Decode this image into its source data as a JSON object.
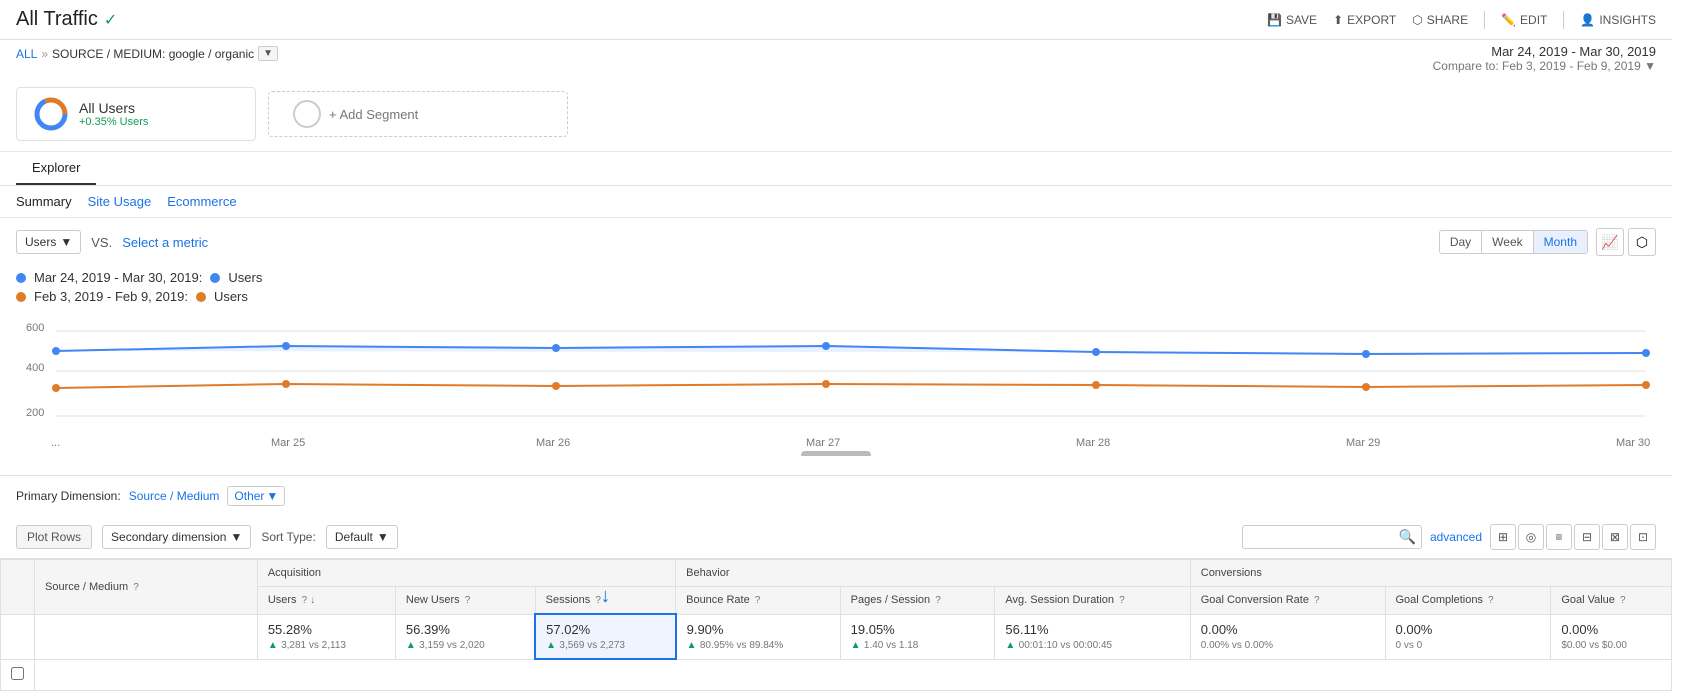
{
  "page": {
    "title": "All Traffic",
    "verified": true
  },
  "header": {
    "actions": [
      {
        "id": "save",
        "label": "SAVE",
        "icon": "💾"
      },
      {
        "id": "export",
        "label": "EXPORT",
        "icon": "📤"
      },
      {
        "id": "share",
        "label": "SHARE",
        "icon": "🔗"
      },
      {
        "id": "edit",
        "label": "EDIT",
        "icon": "✏️"
      },
      {
        "id": "insights",
        "label": "INSIGHTS",
        "icon": "👤"
      }
    ]
  },
  "breadcrumb": {
    "all": "ALL",
    "separator": "»",
    "path": "SOURCE / MEDIUM: google / organic"
  },
  "date_range": {
    "primary": "Mar 24, 2019 - Mar 30, 2019",
    "compare_label": "Compare to:",
    "compare": "Feb 3, 2019 - Feb 9, 2019"
  },
  "segments": {
    "all_users": {
      "name": "All Users",
      "pct": "+0.35% Users"
    },
    "add_label": "+ Add Segment"
  },
  "tabs": {
    "explorer": "Explorer"
  },
  "sub_tabs": [
    {
      "id": "summary",
      "label": "Summary",
      "active": true
    },
    {
      "id": "site_usage",
      "label": "Site Usage",
      "link": true
    },
    {
      "id": "ecommerce",
      "label": "Ecommerce",
      "link": true
    }
  ],
  "chart_controls": {
    "metric": "Users",
    "vs_label": "VS.",
    "select_metric": "Select a metric",
    "time_buttons": [
      "Day",
      "Week",
      "Month"
    ],
    "active_time": "Month"
  },
  "legend": {
    "row1": {
      "date": "Mar 24, 2019 - Mar 30, 2019:",
      "dot_color": "#4285f4",
      "metric": "Users"
    },
    "row2": {
      "date": "Feb 3, 2019 - Feb 9, 2019:",
      "dot_color": "#e07b2a",
      "metric": "Users"
    }
  },
  "chart": {
    "y_labels": [
      "600",
      "400",
      "200"
    ],
    "x_labels": [
      "...",
      "Mar 25",
      "Mar 26",
      "Mar 27",
      "Mar 28",
      "Mar 29",
      "Mar 30"
    ],
    "blue_line": [
      500,
      510,
      500,
      510,
      490,
      490,
      490,
      495
    ],
    "orange_line": [
      345,
      350,
      340,
      345,
      345,
      340,
      340,
      345
    ]
  },
  "primary_dimension": {
    "label": "Primary Dimension:",
    "current": "Source / Medium",
    "other": "Other"
  },
  "table_controls": {
    "plot_rows": "Plot Rows",
    "secondary_dimension": "Secondary dimension",
    "sort_type_label": "Sort Type:",
    "sort_default": "Default",
    "advanced": "advanced"
  },
  "table": {
    "col_groups": [
      {
        "label": "",
        "colspan": 2
      },
      {
        "label": "Acquisition",
        "colspan": 3
      },
      {
        "label": "Behavior",
        "colspan": 3
      },
      {
        "label": "Conversions",
        "colspan": 3
      }
    ],
    "columns": [
      {
        "id": "checkbox",
        "label": ""
      },
      {
        "id": "source_medium",
        "label": "Source / Medium",
        "help": true
      },
      {
        "id": "users",
        "label": "Users",
        "help": true,
        "sort": true
      },
      {
        "id": "new_users",
        "label": "New Users",
        "help": true
      },
      {
        "id": "sessions",
        "label": "Sessions",
        "help": true
      },
      {
        "id": "bounce_rate",
        "label": "Bounce Rate",
        "help": true
      },
      {
        "id": "pages_session",
        "label": "Pages / Session",
        "help": true
      },
      {
        "id": "avg_session",
        "label": "Avg. Session Duration",
        "help": true
      },
      {
        "id": "goal_conv_rate",
        "label": "Goal Conversion Rate",
        "help": true
      },
      {
        "id": "goal_completions",
        "label": "Goal Completions",
        "help": true
      },
      {
        "id": "goal_value",
        "label": "Goal Value",
        "help": true
      }
    ],
    "totals": {
      "users": {
        "pct": "55.28%",
        "trend": "up",
        "sub": "3,281 vs 2,113"
      },
      "new_users": {
        "pct": "56.39%",
        "trend": "up",
        "sub": "3,159 vs 2,020"
      },
      "sessions": {
        "pct": "57.02%",
        "trend": "up",
        "sub": "3,569 vs 2,273",
        "highlighted": true
      },
      "bounce_rate": {
        "pct": "9.90%",
        "trend": "up",
        "sub": "80.95% vs 89.84%"
      },
      "pages_session": {
        "pct": "19.05%",
        "trend": "up",
        "sub": "1.40 vs 1.18"
      },
      "avg_session": {
        "pct": "56.11%",
        "trend": "up",
        "sub": "00:01:10 vs 00:00:45"
      },
      "goal_conv_rate": {
        "pct": "0.00%",
        "trend": null,
        "sub": "0.00% vs 0.00%"
      },
      "goal_completions": {
        "pct": "0.00%",
        "trend": null,
        "sub": "0 vs 0"
      },
      "goal_value": {
        "pct": "0.00%",
        "trend": null,
        "sub": "$0.00 vs $0.00"
      }
    }
  },
  "arrow_indicator": "↓"
}
